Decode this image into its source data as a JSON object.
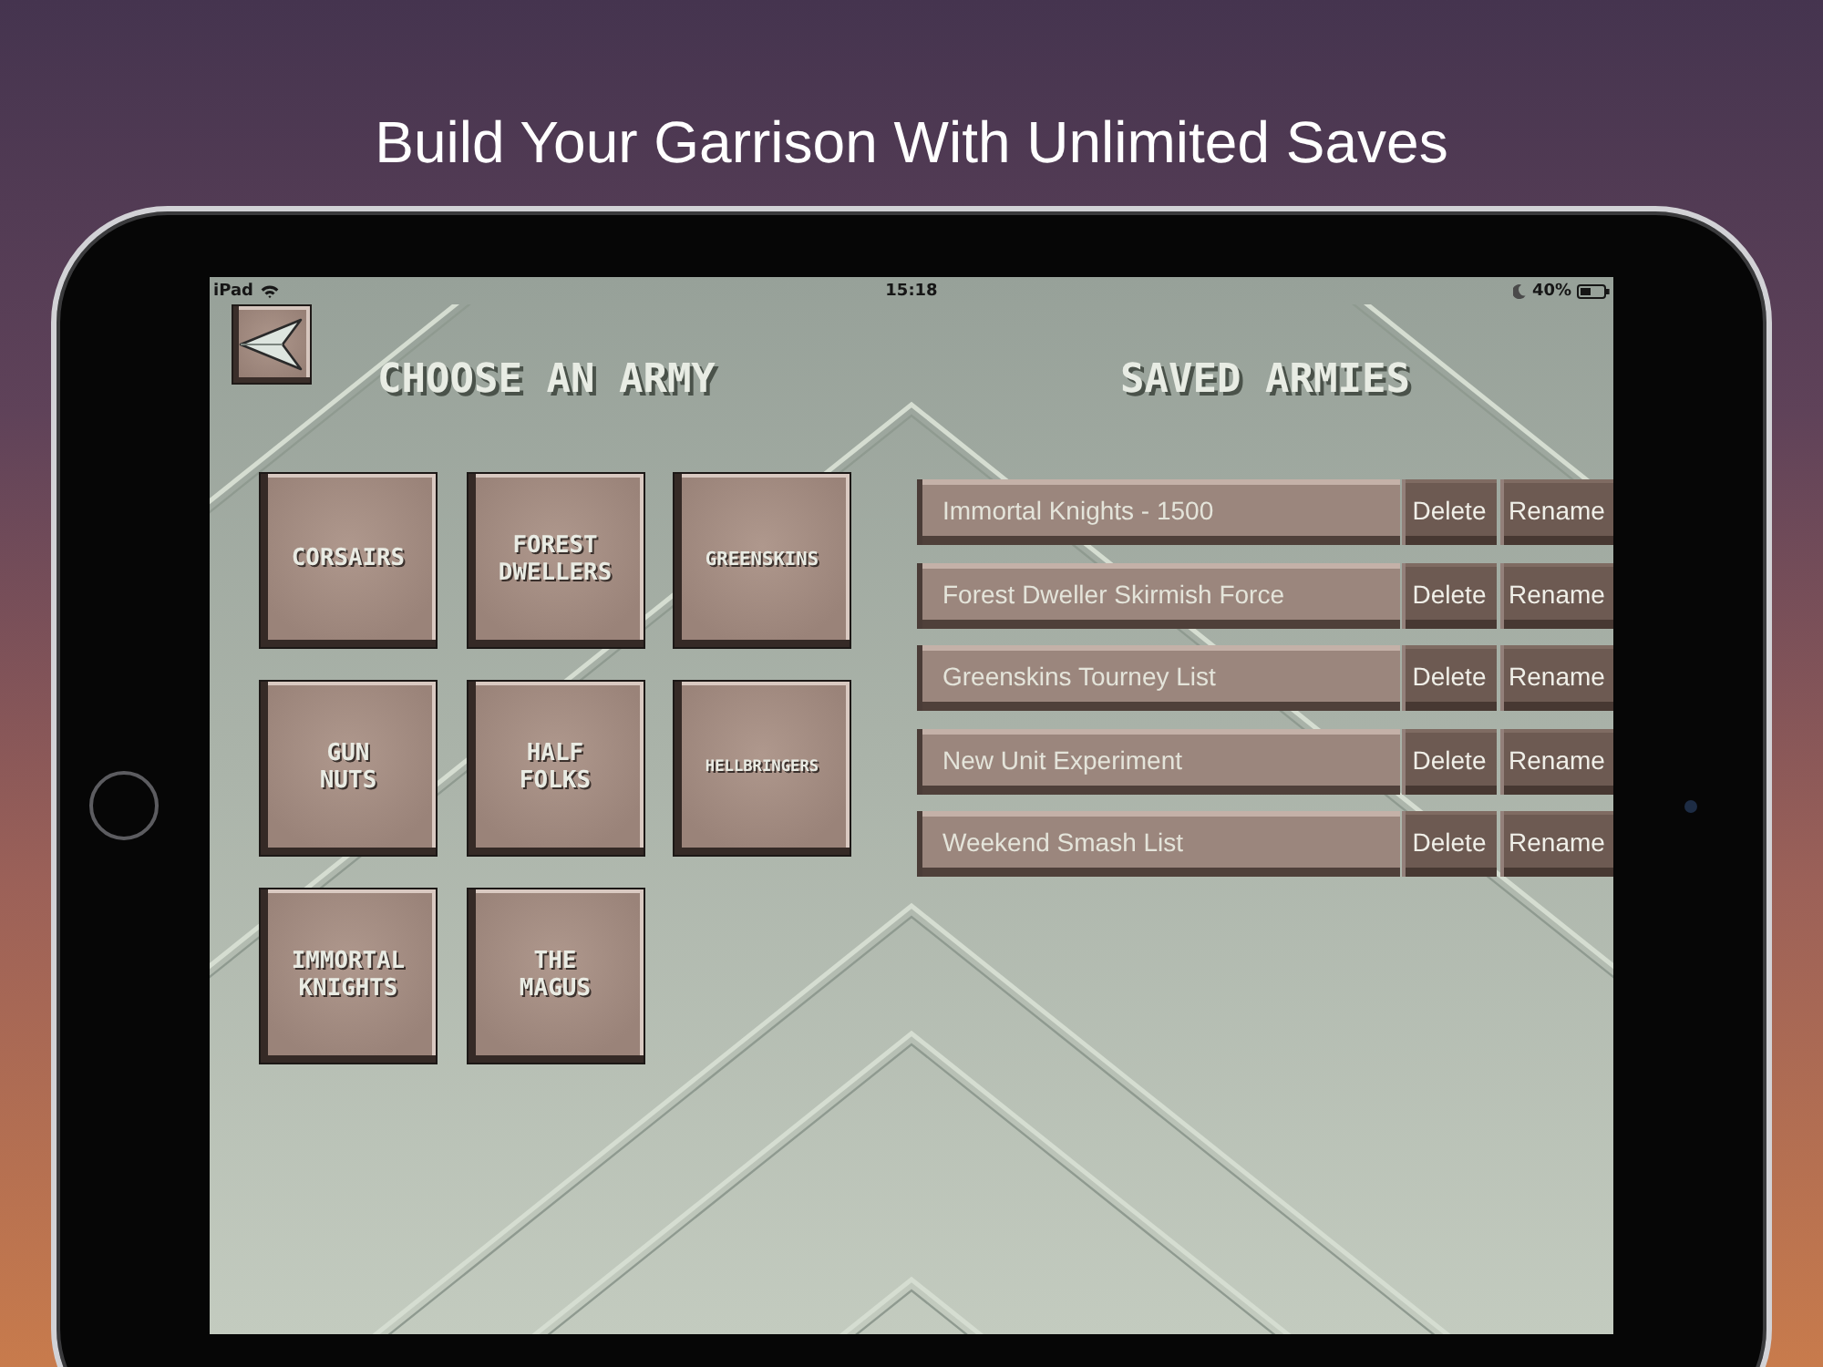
{
  "headline": "Build Your Garrison With Unlimited Saves",
  "status_bar": {
    "device": "iPad",
    "time": "15:18",
    "battery": "40%"
  },
  "choose_panel": {
    "title": "CHOOSE AN ARMY",
    "armies": [
      "CORSAIRS",
      "FOREST DWELLERS",
      "GREENSKINS",
      "GUN NUTS",
      "HALF FOLKS",
      "HELLBRINGERS",
      "IMMORTAL KNIGHTS",
      "THE MAGUS"
    ]
  },
  "saved_panel": {
    "title": "SAVED ARMIES",
    "rows": [
      {
        "name": "Immortal Knights - 1500",
        "delete": "Delete",
        "rename": "Rename"
      },
      {
        "name": "Forest Dweller Skirmish Force",
        "delete": "Delete",
        "rename": "Rename"
      },
      {
        "name": "Greenskins Tourney List",
        "delete": "Delete",
        "rename": "Rename"
      },
      {
        "name": "New Unit Experiment",
        "delete": "Delete",
        "rename": "Rename"
      },
      {
        "name": "Weekend Smash List",
        "delete": "Delete",
        "rename": "Rename"
      }
    ]
  }
}
